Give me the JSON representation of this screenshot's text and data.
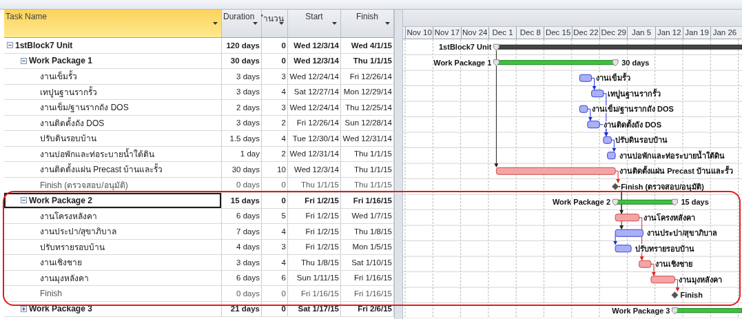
{
  "columns": [
    "Task Name",
    "Duration",
    "ำนวน",
    "Start",
    "Finish"
  ],
  "timescale": [
    "Nov 10",
    "Nov 17",
    "Nov 24",
    "Dec 1",
    "Dec 8",
    "Dec 15",
    "Dec 22",
    "Dec 29",
    "Jan 5",
    "Jan 12",
    "Jan 19",
    "Jan 26"
  ],
  "tasks": [
    {
      "name": "1stBlock7 Unit",
      "kind": "project",
      "expanded": true,
      "selected": false,
      "duration": "120 days",
      "resources": "0",
      "start": "Wed 12/3/14",
      "finish": "Wed 4/1/15",
      "bar_label_left": "1stBlock7 Unit",
      "children": [
        {
          "name": "Work Package 1",
          "kind": "summary",
          "expanded": true,
          "selected": false,
          "highlighted": false,
          "duration": "30 days",
          "resources": "0",
          "start": "Wed 12/3/14",
          "finish": "Thu 1/1/15",
          "bar_label_left": "Work Package 1",
          "bar_label_right": "30 days",
          "children": [
            {
              "name": "งานเข็มรั้ว",
              "kind": "task",
              "critical": false,
              "selected": false,
              "duration": "3 days",
              "resources": "3",
              "start": "Wed 12/24/14",
              "finish": "Fri 12/26/14",
              "bar_label_right": "งานเข็มรั้ว"
            },
            {
              "name": "เทปูนฐานรากรั้ว",
              "kind": "task",
              "critical": false,
              "selected": false,
              "duration": "3 days",
              "resources": "4",
              "start": "Sat 12/27/14",
              "finish": "Mon 12/29/14",
              "bar_label_right": "เทปูนฐานรากรั้ว"
            },
            {
              "name": "งานเข็ม/ฐานรากถัง DOS",
              "kind": "task",
              "critical": false,
              "selected": false,
              "duration": "2 days",
              "resources": "3",
              "start": "Wed 12/24/14",
              "finish": "Thu 12/25/14",
              "bar_label_right": "งานเข็ม/ฐานรากถัง DOS"
            },
            {
              "name": "งานติดตั้งถัง DOS",
              "kind": "task",
              "critical": false,
              "selected": false,
              "duration": "3 days",
              "resources": "2",
              "start": "Fri 12/26/14",
              "finish": "Sun 12/28/14",
              "bar_label_right": "งานติดตั้งถัง DOS"
            },
            {
              "name": "ปรับดินรอบบ้าน",
              "kind": "task",
              "critical": false,
              "selected": false,
              "duration": "1.5 days",
              "resources": "4",
              "start": "Tue 12/30/14",
              "finish": "Wed 12/31/14",
              "bar_label_right": "ปรับดินรอบบ้าน"
            },
            {
              "name": "งานบ่อพักและท่อระบายน้ำใต้ดิน",
              "kind": "task",
              "critical": false,
              "selected": false,
              "duration": "1 day",
              "resources": "2",
              "start": "Wed 12/31/14",
              "finish": "Thu 1/1/15",
              "bar_label_right": "งานบ่อพักและท่อระบายน้ำใต้ดิน"
            },
            {
              "name": "งานติดตั้งแผ่น Precast บ้านและรั้ว",
              "kind": "task",
              "critical": true,
              "selected": false,
              "duration": "30 days",
              "resources": "10",
              "start": "Wed 12/3/14",
              "finish": "Thu 1/1/15",
              "bar_label_right": "งานติดตั้งแผ่น Precast บ้านและรั้ว"
            },
            {
              "name": "Finish (ตรวจสอบ/อนุมัติ)",
              "kind": "milestone",
              "selected": false,
              "duration": "0 days",
              "resources": "0",
              "start": "Thu 1/1/15",
              "finish": "Thu 1/1/15",
              "bar_label_right": "Finish (ตรวจสอบ/อนุมัติ)"
            }
          ]
        },
        {
          "name": "Work Package 2",
          "kind": "summary",
          "expanded": true,
          "selected": true,
          "highlighted": true,
          "duration": "15 days",
          "resources": "0",
          "start": "Fri 1/2/15",
          "finish": "Fri 1/16/15",
          "bar_label_left": "Work Package 2",
          "bar_label_right": "15 days",
          "children": [
            {
              "name": "งานโครงหลังคา",
              "kind": "task",
              "critical": true,
              "selected": false,
              "duration": "6 days",
              "resources": "5",
              "start": "Fri 1/2/15",
              "finish": "Wed 1/7/15",
              "bar_label_right": "งานโครงหลังคา"
            },
            {
              "name": "งานประปา/สุขาภิบาล",
              "kind": "task",
              "critical": false,
              "selected": false,
              "duration": "7 days",
              "resources": "4",
              "start": "Fri 1/2/15",
              "finish": "Thu 1/8/15",
              "bar_label_right": "งานประปา/สุขาภิบาล"
            },
            {
              "name": "ปรับทรายรอบบ้าน",
              "kind": "task",
              "critical": false,
              "selected": false,
              "duration": "4 days",
              "resources": "3",
              "start": "Fri 1/2/15",
              "finish": "Mon 1/5/15",
              "bar_label_right": "ปรับทรายรอบบ้าน"
            },
            {
              "name": "งานเชิงชาย",
              "kind": "task",
              "critical": true,
              "selected": false,
              "duration": "3 days",
              "resources": "4",
              "start": "Thu 1/8/15",
              "finish": "Sat 1/10/15",
              "bar_label_right": "งานเชิงชาย"
            },
            {
              "name": "งานมุงหลังคา",
              "kind": "task",
              "critical": true,
              "selected": false,
              "duration": "6 days",
              "resources": "6",
              "start": "Sun 1/11/15",
              "finish": "Fri 1/16/15",
              "bar_label_right": "งานมุงหลังคา"
            },
            {
              "name": "Finish",
              "kind": "milestone",
              "selected": false,
              "duration": "0 days",
              "resources": "0",
              "start": "Fri 1/16/15",
              "finish": "Fri 1/16/15",
              "bar_label_right": "Finish"
            }
          ]
        },
        {
          "name": "Work Package 3",
          "kind": "summary",
          "expanded": false,
          "selected": false,
          "highlighted": false,
          "duration": "21 days",
          "resources": "0",
          "start": "Sat 1/17/15",
          "finish": "Fri 2/6/15",
          "bar_label_left": "Work Package 3"
        }
      ]
    }
  ]
}
